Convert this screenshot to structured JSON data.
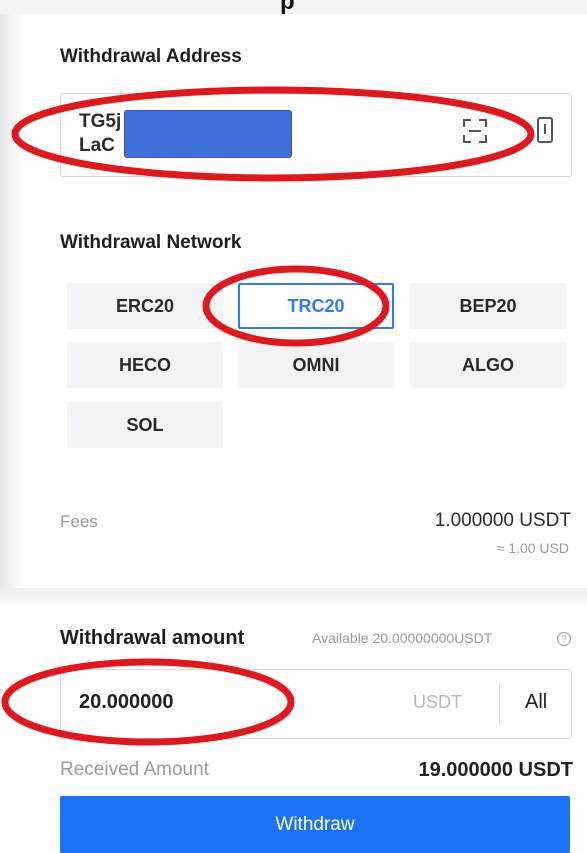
{
  "address_section": {
    "title": "Withdrawal Address",
    "address_text": "TG5j          iKQdZaj7U\nLaC"
  },
  "network_section": {
    "title": "Withdrawal Network",
    "networks": [
      {
        "label": "ERC20",
        "selected": false
      },
      {
        "label": "TRC20",
        "selected": true
      },
      {
        "label": "BEP20",
        "selected": false
      },
      {
        "label": "HECO",
        "selected": false
      },
      {
        "label": "OMNI",
        "selected": false
      },
      {
        "label": "ALGO",
        "selected": false
      },
      {
        "label": "SOL",
        "selected": false
      }
    ]
  },
  "fees": {
    "label": "Fees",
    "value": "1.000000 USDT",
    "approx": "≈ 1.00 USD"
  },
  "amount_section": {
    "title": "Withdrawal amount",
    "available": "Available 20.00000000USDT",
    "value": "20.000000",
    "unit": "USDT",
    "all_label": "All"
  },
  "received": {
    "label": "Received Amount",
    "value": "19.000000 USDT"
  },
  "withdraw_button": {
    "label": "Withdraw"
  },
  "colors": {
    "accent": "#1a73f5",
    "selected_border": "#2f7cf6",
    "annotation_red": "#e0181b",
    "redaction_blue": "#3f6fd8"
  },
  "icons": [
    "scan-icon",
    "clipboard-icon",
    "info-icon"
  ]
}
